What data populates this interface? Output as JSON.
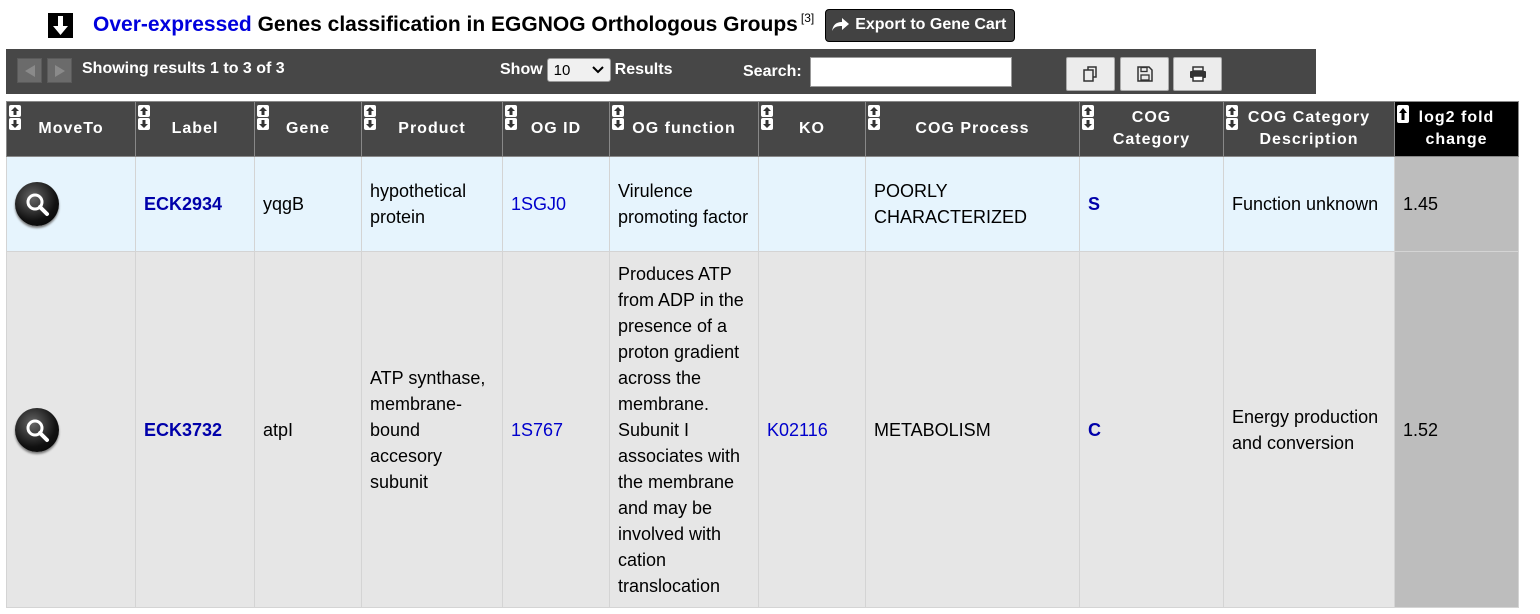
{
  "title": {
    "highlight": "Over-expressed",
    "rest": " Genes classification in EGGNOG Orthologous Groups",
    "footnote": "[3]"
  },
  "export_button": {
    "label": "Export to Gene Cart"
  },
  "toolbar": {
    "info": "Showing results 1 to 3 of 3",
    "show_label": "Show",
    "page_size": "10",
    "results_label": "Results",
    "search_label": "Search:",
    "search_value": ""
  },
  "columns": [
    "MoveTo",
    "Label",
    "Gene",
    "Product",
    "OG ID",
    "OG function",
    "KO",
    "COG Process",
    "COG Category",
    "COG Category Description",
    "log2 fold change"
  ],
  "rows": [
    {
      "label": "ECK2934",
      "gene": "yqgB",
      "product": "hypothetical protein",
      "og_id": "1SGJ0",
      "og_function": "Virulence promoting factor",
      "ko": "",
      "cog_process": "POORLY CHARACTERIZED",
      "cog_category": "S",
      "cog_desc": "Function unknown",
      "fold": "1.45"
    },
    {
      "label": "ECK3732",
      "gene": "atpI",
      "product": "ATP synthase, membrane-bound accesory subunit",
      "og_id": "1S767",
      "og_function": "Produces ATP from ADP in the presence of a proton gradient across the membrane. Subunit I associates with the membrane and may be involved with cation translocation",
      "ko": "K02116",
      "cog_process": "METABOLISM",
      "cog_category": "C",
      "cog_desc": "Energy production and conversion",
      "fold": "1.52"
    }
  ],
  "colors": {
    "header_bg": "#474747",
    "row_odd": "#e6f4fd",
    "row_even": "#e6e6e6",
    "fold_bg": "#bdbdbd",
    "link": "#0000cc",
    "title_highlight": "#0000dd"
  },
  "icons": {
    "collapse": "arrow-down-icon",
    "export": "share-arrow-icon",
    "prev": "triangle-left-icon",
    "next": "triangle-right-icon",
    "copy": "copy-icon",
    "save": "floppy-disk-icon",
    "print": "printer-icon",
    "moveto": "magnifier-icon"
  }
}
